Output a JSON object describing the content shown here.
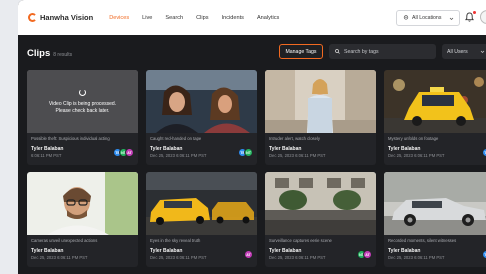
{
  "app": {
    "logo_text": "Hanwha Vision"
  },
  "nav": {
    "items": [
      "Devices",
      "Live",
      "Search",
      "Clips",
      "Incidents",
      "Analytics"
    ],
    "active": "Devices"
  },
  "location_select": {
    "value": "All Locations"
  },
  "page": {
    "title": "Clips",
    "count": "8 results"
  },
  "toolbar": {
    "manage_tags": "Manage Tags",
    "search_placeholder": "Search by tags",
    "users_filter": "All Users"
  },
  "processing": {
    "line1": "Video Clip is being processed.",
    "line2": "Please check back later."
  },
  "clips": [
    {
      "description": "Possible theft: Suspicious individual acting",
      "owner": "Tyler Balaban",
      "date": "6:06:11 PM PST",
      "tags": [
        {
          "t": "TE",
          "c": "#2d8cf0"
        },
        {
          "t": "NT",
          "c": "#22b35e"
        },
        {
          "t": "AT",
          "c": "#c33cb8"
        }
      ]
    },
    {
      "description": "Caught red-handed on tape",
      "owner": "Tyler Balaban",
      "date": "Dec 25, 2023 6:06:11 PM PST",
      "tags": [
        {
          "t": "TE",
          "c": "#2d8cf0"
        },
        {
          "t": "NT",
          "c": "#22b35e"
        }
      ]
    },
    {
      "description": "Intruder alert, watch closely",
      "owner": "Tyler Balaban",
      "date": "Dec 25, 2023 6:06:11 PM PST",
      "tags": []
    },
    {
      "description": "Mystery unfolds on footage",
      "owner": "Tyler Balaban",
      "date": "Dec 25, 2023 6:06:11 PM PST",
      "tags": [
        {
          "t": "TE",
          "c": "#2d8cf0"
        }
      ]
    },
    {
      "description": "Cameras unveil unexpected actions",
      "owner": "Tyler Balaban",
      "date": "Dec 25, 2023 6:06:11 PM PST",
      "tags": []
    },
    {
      "description": "Eyes in the sky reveal truth",
      "owner": "Tyler Balaban",
      "date": "Dec 25, 2023 6:06:11 PM PST",
      "tags": [
        {
          "t": "AT",
          "c": "#c33cb8"
        }
      ]
    },
    {
      "description": "Surveillance captures eerie scene",
      "owner": "Tyler Balaban",
      "date": "Dec 25, 2023 6:06:11 PM PST",
      "tags": [
        {
          "t": "NT",
          "c": "#22b35e"
        },
        {
          "t": "AT",
          "c": "#c33cb8"
        }
      ]
    },
    {
      "description": "Recorded moments, silent witnesses",
      "owner": "Tyler Balaban",
      "date": "Dec 25, 2023 6:06:11 PM PST",
      "tags": [
        {
          "t": "TE",
          "c": "#2d8cf0"
        }
      ]
    }
  ],
  "colors": {
    "accent": "#f26a21",
    "background": "#1a1b1e",
    "card": "#232428"
  }
}
